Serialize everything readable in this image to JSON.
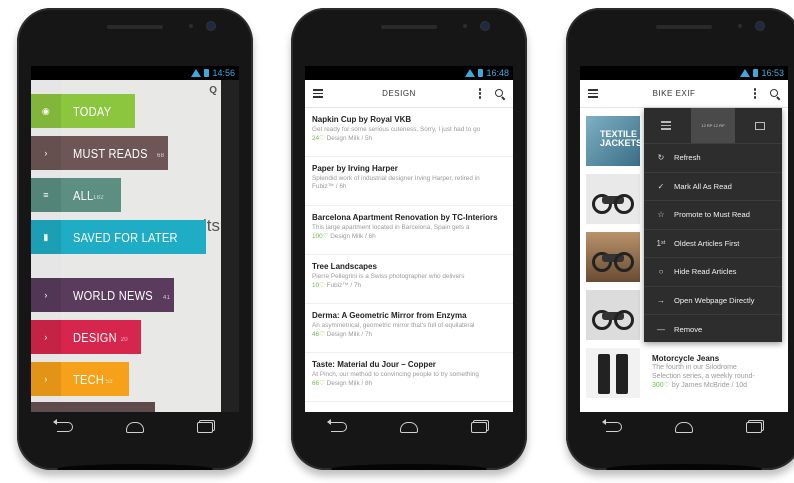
{
  "phone1": {
    "time": "14:56",
    "ghost_text": "its",
    "menu": [
      {
        "label": "TODAY",
        "count": "",
        "icon": "eye-icon",
        "glyph": "◉",
        "color": "#8cc63f"
      },
      {
        "label": "MUST READS",
        "count": "68",
        "icon": "chevron-right-icon",
        "glyph": "›",
        "color": "#6e5656"
      },
      {
        "label": "ALL",
        "count": "182",
        "icon": "list-icon",
        "glyph": "≡",
        "color": "#5c8f82"
      },
      {
        "label": "SAVED FOR LATER",
        "count": "",
        "icon": "bookmark-icon",
        "glyph": "▮",
        "color": "#1fadc5"
      },
      {
        "label": "WORLD NEWS",
        "count": "41",
        "icon": "chevron-right-icon",
        "glyph": "›",
        "color": "#5a3b5e"
      },
      {
        "label": "DESIGN",
        "count": "20",
        "icon": "chevron-right-icon",
        "glyph": "›",
        "color": "#d6264d"
      },
      {
        "label": "TECH",
        "count": "53",
        "icon": "chevron-right-icon",
        "glyph": "›",
        "color": "#f7a11a"
      }
    ]
  },
  "phone2": {
    "time": "16:48",
    "title": "DESIGN",
    "articles": [
      {
        "title": "Napkin Cup by Royal VKB",
        "snippet": "Get ready for some serious cuteness. Sorry, I just had to go",
        "count": "24♡",
        "source": "Design Milk / 5h"
      },
      {
        "title": "Paper by Irving Harper",
        "snippet": "Splendid work of industrial designer Irving Harper, retired in",
        "count": "",
        "source": "Fubiz™ / 6h"
      },
      {
        "title": "Barcelona Apartment Renovation by TC-Interiors",
        "snippet": "This large apartment located in Barcelona, Spain gets a",
        "count": "100♡",
        "source": "Design Milk / 6h"
      },
      {
        "title": "Tree Landscapes",
        "snippet": "Pierre Pellegrini is a Swiss photographer who delivers",
        "count": "10♡",
        "source": "Fubiz™ / 7h"
      },
      {
        "title": "Derma: A Geometric Mirror from Enzyma",
        "snippet": "An asymmetrical, geometric mirror that's full of equilateral",
        "count": "46♡",
        "source": "Design Milk / 7h"
      },
      {
        "title": "Taste: Material du Jour – Copper",
        "snippet": "At Pinch, our method to convincing people to try something",
        "count": "66♡",
        "source": "Design Milk / 8h"
      }
    ]
  },
  "phone3": {
    "time": "16:53",
    "title": "BIKE EXIF",
    "thumb_text": "TEXTILE JACKETS",
    "view_mag_text": "12 RP 12 RP",
    "menu": [
      {
        "label": "Refresh",
        "icon": "refresh-icon",
        "glyph": "↻"
      },
      {
        "label": "Mark All As Read",
        "icon": "check-icon",
        "glyph": "✓"
      },
      {
        "label": "Promote to Must Read",
        "icon": "star-icon",
        "glyph": "☆"
      },
      {
        "label": "Oldest Articles First",
        "icon": "sort-icon",
        "glyph": "1ˢᵗ"
      },
      {
        "label": "Hide Read Articles",
        "icon": "circle-icon",
        "glyph": "○"
      },
      {
        "label": "Open Webpage Directly",
        "icon": "arrow-right-icon",
        "glyph": "→"
      },
      {
        "label": "Remove",
        "icon": "minus-icon",
        "glyph": "—"
      }
    ],
    "list_item": {
      "title": "Motorcycle Jeans",
      "snippet1": "The fourth in our Silodrome",
      "snippet2": "Selection series, a weekly round-",
      "count": "300♡",
      "source": "by James McBride / 10d"
    }
  }
}
